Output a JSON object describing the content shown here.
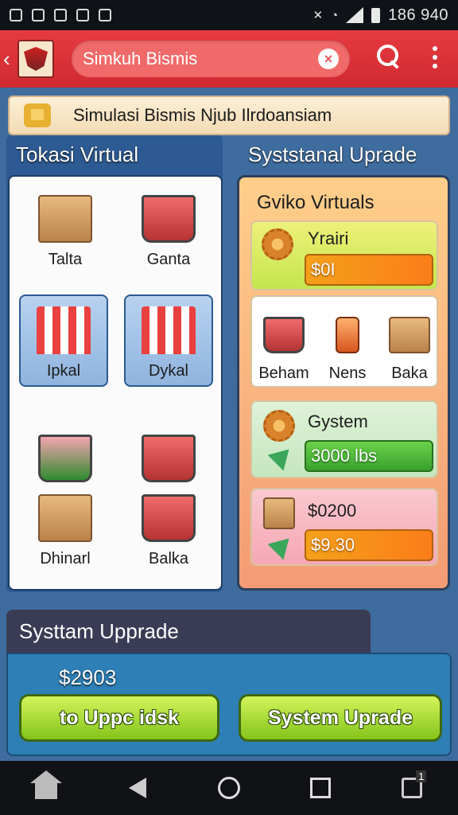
{
  "status_bar": {
    "time": "186 940"
  },
  "header": {
    "search_text": "Simkuh Bismis"
  },
  "banner": {
    "text": "Simulasi Bismis Njub Ilrdoansiam"
  },
  "left_panel": {
    "title": "Tokasi Virtual",
    "items": [
      {
        "label": "Talta",
        "icon": "box-icon"
      },
      {
        "label": "Ganta",
        "icon": "cart-icon"
      },
      {
        "label": "Ipkal",
        "icon": "stall-icon"
      },
      {
        "label": "Dykal",
        "icon": "stall-icon"
      },
      {
        "label": "",
        "icon": "cart-icon"
      },
      {
        "label": "",
        "icon": "cart-icon"
      },
      {
        "label": "Dhinarl",
        "icon": "box-icon"
      },
      {
        "label": "Balka",
        "icon": "cart-icon"
      }
    ]
  },
  "right_panel": {
    "title": "Syststanal Uprade",
    "subtitle": "Gviko Virtuals",
    "card1": {
      "label": "Yrairi",
      "value": "$0I",
      "fill": 0.8
    },
    "card2_items": [
      {
        "label": "Beham"
      },
      {
        "label": "Nens"
      },
      {
        "label": "Baka"
      }
    ],
    "card3": {
      "label": "Gystem",
      "value": "3000 lbs",
      "fill": 0.9
    },
    "card4": {
      "label": "$0200",
      "value": "$9.30",
      "fill": 0.6
    }
  },
  "bottom": {
    "title": "Systtam Upprade",
    "price": "$2903",
    "btn_left": "to Uppc idsk",
    "btn_right": "System Uprade"
  },
  "colors": {
    "appbar": "#d02a31",
    "accent": "#84c41b"
  }
}
